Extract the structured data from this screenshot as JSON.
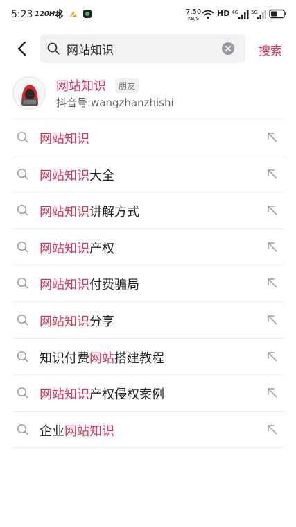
{
  "status_bar": {
    "time": "5:23",
    "refresh_rate": "120Hz",
    "net_speed_value": "7.50",
    "net_speed_unit": "KB/S",
    "hd_label": "HD",
    "battery_icon": "battery-icon"
  },
  "header": {
    "back_icon": "chevron-left-icon",
    "search": {
      "value": "网站知识",
      "icon": "search-icon",
      "clear_icon": "clear-icon"
    },
    "submit_label": "搜索"
  },
  "user_card": {
    "name": "网站知识",
    "tag": "朋友",
    "douyin_id": "抖音号:wangzhanzhishi"
  },
  "suggestions": [
    {
      "parts": [
        {
          "text": "网站知识",
          "hl": true
        }
      ]
    },
    {
      "parts": [
        {
          "text": "网站知识",
          "hl": true
        },
        {
          "text": "大全",
          "hl": false
        }
      ]
    },
    {
      "parts": [
        {
          "text": "网站知识",
          "hl": true
        },
        {
          "text": "讲解方式",
          "hl": false
        }
      ]
    },
    {
      "parts": [
        {
          "text": "网站知识",
          "hl": true
        },
        {
          "text": "产权",
          "hl": false
        }
      ]
    },
    {
      "parts": [
        {
          "text": "网站知识",
          "hl": true
        },
        {
          "text": "付费骗局",
          "hl": false
        }
      ]
    },
    {
      "parts": [
        {
          "text": "网站知识",
          "hl": true
        },
        {
          "text": "分享",
          "hl": false
        }
      ]
    },
    {
      "parts": [
        {
          "text": "知识付费",
          "hl": false
        },
        {
          "text": "网站",
          "hl": true
        },
        {
          "text": "搭建教程",
          "hl": false
        }
      ]
    },
    {
      "parts": [
        {
          "text": "网站知识",
          "hl": true
        },
        {
          "text": "产权侵权案例",
          "hl": false
        }
      ]
    },
    {
      "parts": [
        {
          "text": "企业",
          "hl": false
        },
        {
          "text": "网站知识",
          "hl": true
        }
      ]
    }
  ],
  "colors": {
    "accent": "#e2345a",
    "text": "#222222",
    "secondary_text": "#666666",
    "search_bg": "#f2f2f4"
  }
}
